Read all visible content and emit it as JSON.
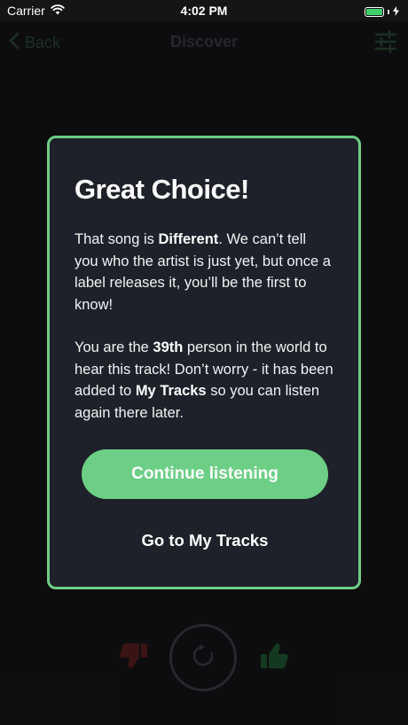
{
  "status_bar": {
    "carrier": "Carrier",
    "time": "4:02 PM",
    "battery_level": 1.0,
    "battery_color": "#3ecf6b"
  },
  "nav": {
    "back_label": "Back",
    "title": "Discover",
    "back_icon": "chevron-left-icon",
    "filter_icon": "sliders-icon"
  },
  "modal": {
    "title": "Great Choice!",
    "para1": {
      "before": "That song is ",
      "bold": "Different",
      "after": ". We can’t tell you who the artist is just yet, but once a label releases it, you’ll be the first to know!"
    },
    "para2": {
      "before": "You are the ",
      "bold1": "39th",
      "middle": " person in the world to hear this track! Don’t worry - it has been added to ",
      "bold2": "My Tracks",
      "after": " so you can listen again there later."
    },
    "continue_label": "Continue listening",
    "tracks_label": "Go to My Tracks",
    "accent_color": "#6ccf85"
  },
  "controls": {
    "thumbs_down_icon": "thumbs-down-icon",
    "replay_icon": "replay-icon",
    "thumbs_up_icon": "thumbs-up-icon"
  }
}
